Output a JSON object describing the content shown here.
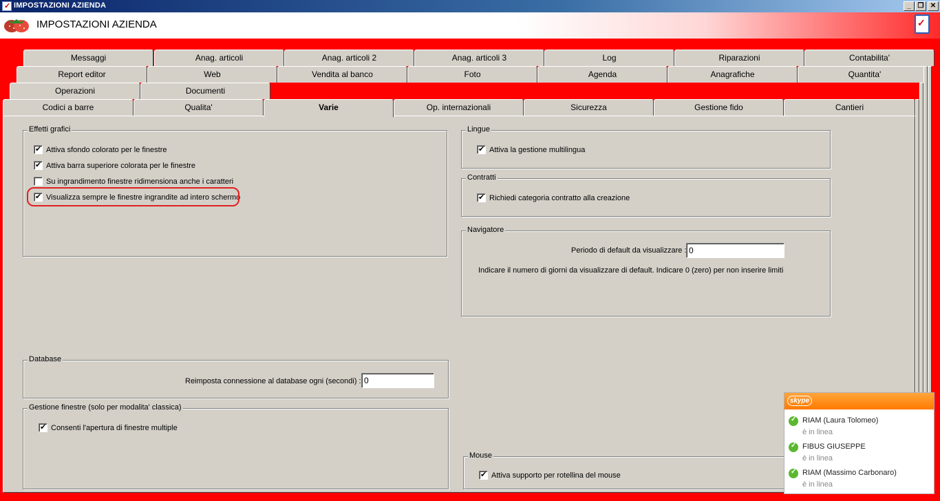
{
  "window": {
    "title": "IMPOSTAZIONI AZIENDA",
    "minimize": "_",
    "restore": "❐",
    "close": "✕"
  },
  "banner": {
    "heading": "IMPOSTAZIONI AZIENDA",
    "logo_icon": "strawberry-logo",
    "right_icon": "checklist-icon"
  },
  "tabs": {
    "row1": [
      "Messaggi",
      "Anag. articoli",
      "Anag. articoli 2",
      "Anag. articoli 3",
      "Log",
      "Riparazioni",
      "Contabilita'"
    ],
    "row2": [
      "Report editor",
      "Web",
      "Vendita al banco",
      "Foto",
      "Agenda",
      "Anagrafiche",
      "Quantita'"
    ],
    "row3": [
      "Operazioni",
      "Documenti"
    ],
    "row4": [
      "Codici a barre",
      "Qualita'",
      "Varie",
      "Op. internazionali",
      "Sicurezza",
      "Gestione fido",
      "Cantieri"
    ],
    "active": "Varie"
  },
  "effetti": {
    "legend": "Effetti grafici",
    "items": [
      {
        "label": "Attiva sfondo colorato per le finestre",
        "checked": true
      },
      {
        "label": "Attiva barra superiore colorata per le finestre",
        "checked": true
      },
      {
        "label": "Su ingrandimento finestre ridimensiona anche i caratteri",
        "checked": false
      },
      {
        "label": "Visualizza sempre le finestre ingrandite ad intero schermo",
        "checked": true
      }
    ]
  },
  "database": {
    "legend": "Database",
    "label": "Reimposta connessione al database ogni (secondi) :",
    "value": "0"
  },
  "gestione_finestre": {
    "legend": "Gestione finestre (solo per modalita' classica)",
    "item": "Consenti l'apertura di finestre multiple"
  },
  "lingue": {
    "legend": "Lingue",
    "item": "Attiva la gestione multilingua"
  },
  "contratti": {
    "legend": "Contratti",
    "item": "Richiedi categoria contratto alla creazione"
  },
  "navigatore": {
    "legend": "Navigatore",
    "label": "Periodo di default da visualizzare :",
    "value": "0",
    "hint": "Indicare il numero di giorni da visualizzare di default. Indicare 0 (zero) per non inserire limiti"
  },
  "mouse": {
    "legend": "Mouse",
    "item": "Attiva supporto per rotellina del mouse"
  },
  "skype": {
    "brand": "skype",
    "contacts": [
      {
        "name": "RIAM (Laura Tolomeo)",
        "presence": "è in linea"
      },
      {
        "name": "FIBUS GIUSEPPE",
        "presence": "è in linea"
      },
      {
        "name": "RIAM (Massimo Carbonaro)",
        "presence": "è in linea"
      }
    ]
  },
  "colors": {
    "accent_red": "#ff0000",
    "highlight_ring": "#e02020",
    "skype_orange": "#ff7a00",
    "online_green": "#5bb82f"
  }
}
